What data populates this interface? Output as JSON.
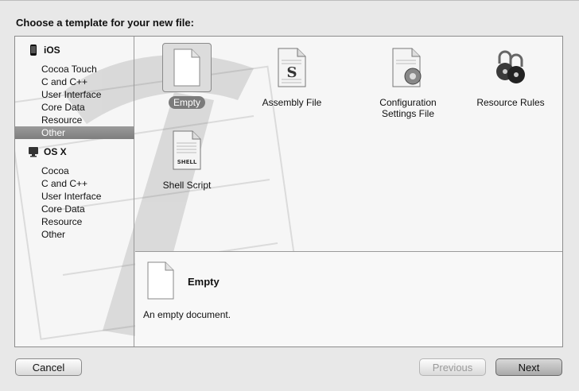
{
  "sheet": {
    "title": "Choose a template for your new file:"
  },
  "sidebar": {
    "groups": [
      {
        "name": "iOS",
        "icon": "iphone-icon",
        "items": [
          "Cocoa Touch",
          "C and C++",
          "User Interface",
          "Core Data",
          "Resource",
          "Other"
        ]
      },
      {
        "name": "OS X",
        "icon": "mac-icon",
        "items": [
          "Cocoa",
          "C and C++",
          "User Interface",
          "Core Data",
          "Resource",
          "Other"
        ]
      }
    ],
    "selected": "iOS / Other"
  },
  "templates": [
    {
      "label": "Empty",
      "icon": "blank-document-icon",
      "selected": true
    },
    {
      "label": "Assembly File",
      "icon": "assembly-file-icon"
    },
    {
      "label_lines": [
        "Configuration",
        "Settings File"
      ],
      "icon": "configuration-file-icon"
    },
    {
      "label": "Resource Rules",
      "icon": "padlocks-icon"
    },
    {
      "label": "Shell Script",
      "icon": "shell-script-icon",
      "badge": "SHELL"
    }
  ],
  "detail": {
    "name": "Empty",
    "description": "An empty document.",
    "icon": "blank-document-icon"
  },
  "buttons": {
    "cancel": "Cancel",
    "previous": "Previous",
    "next": "Next"
  }
}
